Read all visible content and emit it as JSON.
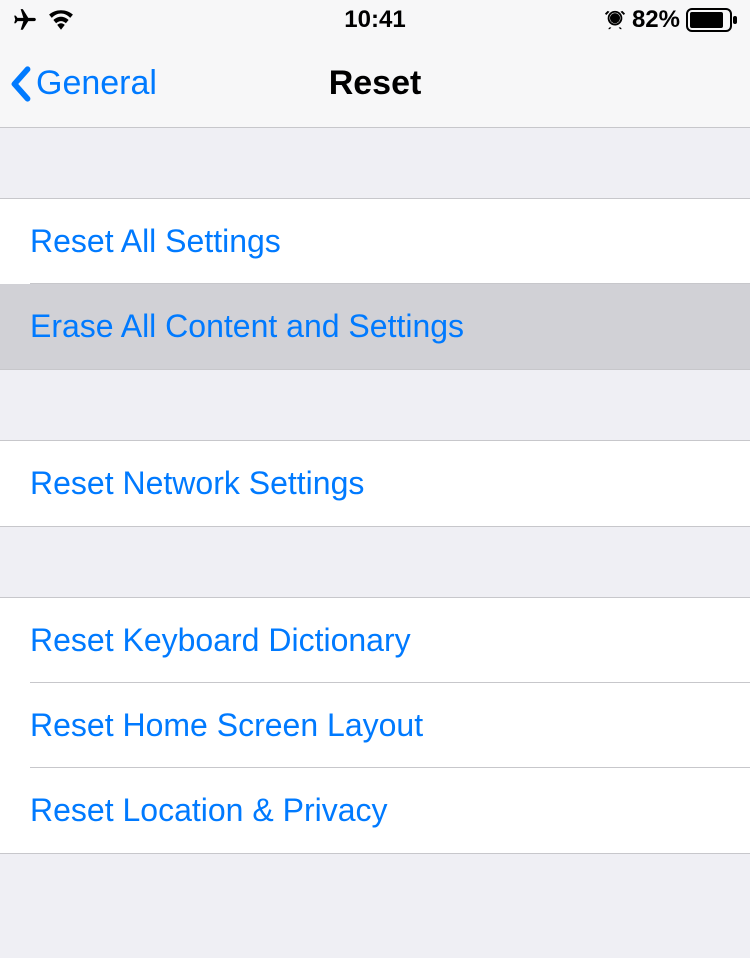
{
  "status": {
    "time": "10:41",
    "battery_pct": "82%"
  },
  "nav": {
    "back_label": "General",
    "title": "Reset"
  },
  "groups": [
    {
      "items": [
        {
          "label": "Reset All Settings",
          "highlighted": false
        },
        {
          "label": "Erase All Content and Settings",
          "highlighted": true
        }
      ]
    },
    {
      "items": [
        {
          "label": "Reset Network Settings",
          "highlighted": false
        }
      ]
    },
    {
      "items": [
        {
          "label": "Reset Keyboard Dictionary",
          "highlighted": false
        },
        {
          "label": "Reset Home Screen Layout",
          "highlighted": false
        },
        {
          "label": "Reset Location & Privacy",
          "highlighted": false
        }
      ]
    }
  ]
}
